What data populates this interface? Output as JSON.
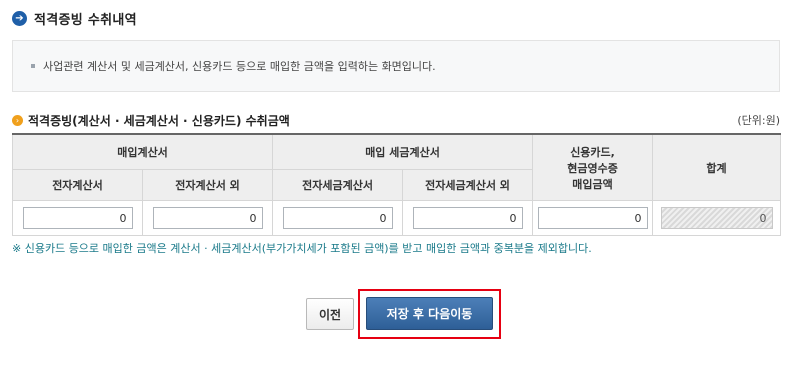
{
  "page": {
    "title": "적격증빙 수취내역"
  },
  "info": {
    "text": "사업관련 계산서 및 세금계산서, 신용카드 등으로 매입한 금액을 입력하는 화면입니다."
  },
  "section": {
    "title": "적격증빙(계산서 · 세금계산서 · 신용카드) 수취금액",
    "unit": "(단위:원)"
  },
  "table": {
    "group_purchase_invoice": "매입계산서",
    "group_purchase_tax_invoice": "매입 세금계산서",
    "card_header_line1": "신용카드,",
    "card_header_line2": "현금영수증",
    "card_header_line3": "매입금액",
    "total_header": "합계",
    "col_e_invoice": "전자계산서",
    "col_non_e_invoice": "전자계산서 외",
    "col_e_tax_invoice": "전자세금계산서",
    "col_non_e_tax_invoice": "전자세금계산서 외",
    "values": {
      "e_invoice": "0",
      "non_e_invoice": "0",
      "e_tax_invoice": "0",
      "non_e_tax_invoice": "0",
      "card_cash": "0",
      "total": "0"
    }
  },
  "note": {
    "text": "※ 신용카드 등으로 매입한 금액은 계산서 · 세금계산서(부가가치세가 포함된 금액)를 받고 매입한 금액과 중복분을 제외합니다."
  },
  "buttons": {
    "prev": "이전",
    "next": "저장 후 다음이동"
  },
  "colors": {
    "accent_blue": "#2e5f97",
    "highlight_red": "#e60012",
    "section_orange": "#f0a01c",
    "note_teal": "#1a7a8a"
  }
}
